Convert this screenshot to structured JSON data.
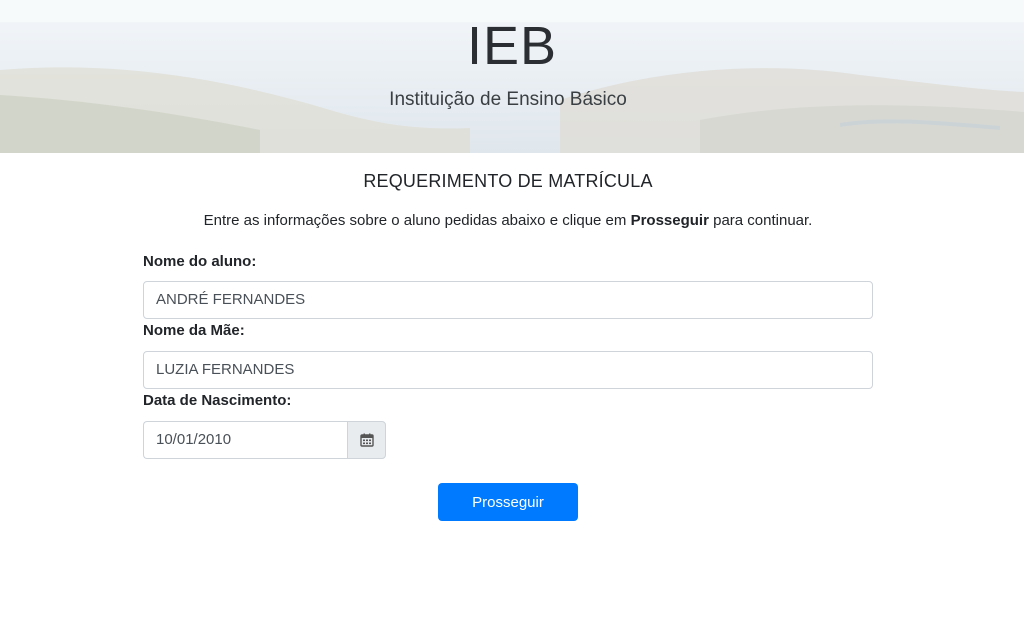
{
  "header": {
    "title": "IEB",
    "subtitle": "Instituição de Ensino Básico"
  },
  "form": {
    "title": "REQUERIMENTO DE MATRÍCULA",
    "intro_before": "Entre as informações sobre o aluno pedidas abaixo e clique em ",
    "intro_bold": "Prosseguir",
    "intro_after": " para continuar.",
    "student_name_label": "Nome do aluno:",
    "student_name_value": "ANDRÉ FERNANDES",
    "mother_name_label": "Nome da Mãe:",
    "mother_name_value": "LUZIA FERNANDES",
    "birth_date_label": "Data de Nascimento:",
    "birth_date_value": "10/01/2010",
    "calendar_icon": "calendar-icon",
    "submit_label": "Prosseguir"
  },
  "colors": {
    "primary": "#007bff",
    "input_border": "#ced4da",
    "addon_bg": "#e9ecef"
  }
}
